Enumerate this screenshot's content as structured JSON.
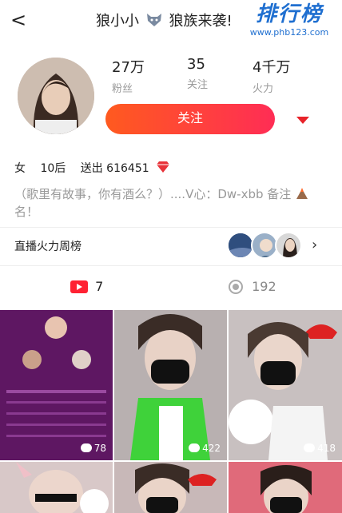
{
  "header": {
    "back_glyph": "<",
    "title_left": "狼小小",
    "title_right": "狼族来袭!",
    "watermark_cn": "排行榜",
    "watermark_url": "www.phb123.com"
  },
  "stats": [
    {
      "value": "27万",
      "label": "粉丝"
    },
    {
      "value": "35",
      "label": "关注"
    },
    {
      "value": "4千万",
      "label": "火力"
    }
  ],
  "follow_label": "关注",
  "profile": {
    "gender": "女",
    "age": "10后",
    "sent": "送出 616451"
  },
  "bio": "（歌里有故事，你有酒么？）....V心：Dw-xbb 备注",
  "bio_tail": "名！",
  "rank": {
    "label": "直播火力周榜",
    "arrow": "›"
  },
  "tabs": [
    {
      "icon": "video-icon",
      "count": "7"
    },
    {
      "icon": "camera-icon",
      "count": "192"
    }
  ],
  "videos": [
    {
      "likes": "78"
    },
    {
      "likes": "422"
    },
    {
      "likes": "418"
    },
    {
      "likes": ""
    },
    {
      "likes": ""
    },
    {
      "likes": ""
    }
  ],
  "colors": {
    "accent": "#ff3b3b",
    "follow_gradient_start": "#ff5a1f",
    "follow_gradient_end": "#ff2d55",
    "muted": "#999999"
  }
}
